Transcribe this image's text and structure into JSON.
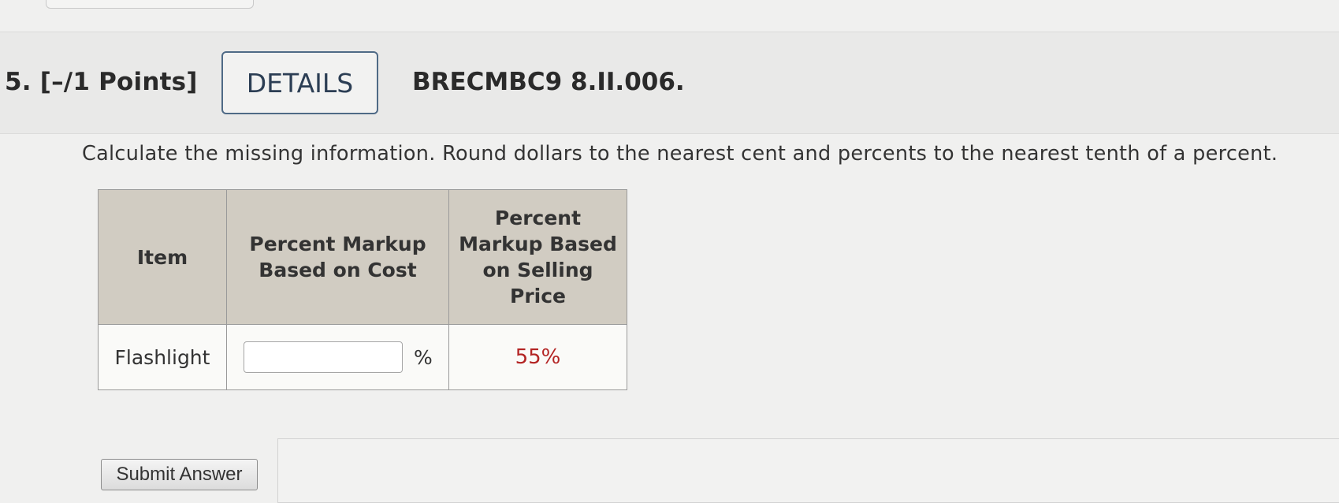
{
  "question": {
    "number_points": "5. [–/1 Points]",
    "details_label": "DETAILS",
    "code": "BRECMBC9 8.II.006."
  },
  "instructions": "Calculate the missing information. Round dollars to the nearest cent and percents to the nearest tenth of a percent.",
  "table": {
    "headers": [
      "Item",
      "Percent Markup Based on Cost",
      "Percent Markup Based on Selling Price"
    ],
    "row": {
      "item": "Flashlight",
      "input_value": "",
      "input_suffix": "%",
      "selling_price_markup": "55%"
    }
  },
  "submit_label": "Submit Answer",
  "colors": {
    "given_value": "#b32424",
    "details_border": "#4f6a86",
    "header_bg": "#d1ccc2"
  }
}
